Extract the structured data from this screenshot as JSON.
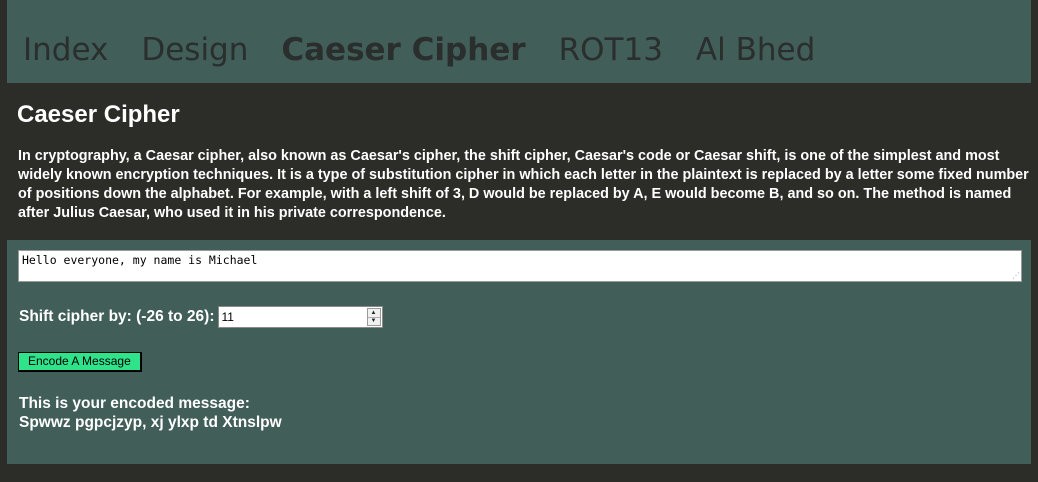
{
  "nav": {
    "items": [
      {
        "label": "Index",
        "active": false
      },
      {
        "label": "Design",
        "active": false
      },
      {
        "label": "Caeser Cipher",
        "active": true
      },
      {
        "label": "ROT13",
        "active": false
      },
      {
        "label": "Al Bhed",
        "active": false
      }
    ]
  },
  "page": {
    "title": "Caeser Cipher",
    "intro": "In cryptography, a Caesar cipher, also known as Caesar's cipher, the shift cipher, Caesar's code or Caesar shift, is one of the simplest and most widely known encryption techniques. It is a type of substitution cipher in which each letter in the plaintext is replaced by a letter some fixed number of positions down the alphabet. For example, with a left shift of 3, D would be replaced by A, E would become B, and so on. The method is named after Julius Caesar, who used it in his private correspondence."
  },
  "form": {
    "message_value": "Hello everyone, my name is Michael",
    "shift_label": "Shift cipher by: (-26 to 26):",
    "shift_value": "11",
    "encode_label": "Encode A Message",
    "result_label": "This is your encoded message:",
    "result_value": "Spwwz pgpcjzyp, xj ylxp td Xtnslpw"
  },
  "colors": {
    "background": "#2c2c28",
    "nav_bg": "#415e59",
    "panel_bg": "#415e59",
    "button_bg": "#2ee38a",
    "nav_text": "#2a2e2c",
    "body_text": "#ffffff"
  },
  "icons": {
    "spin_up": "triangle-up-icon",
    "spin_down": "triangle-down-icon",
    "resize": "resize-grip-icon"
  }
}
